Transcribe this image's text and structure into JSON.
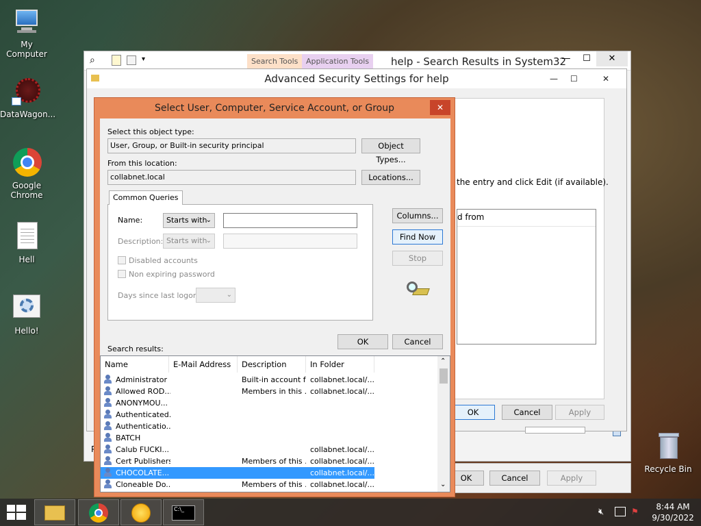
{
  "desktop": {
    "icons": [
      {
        "label": "My Computer"
      },
      {
        "label": "DataWagon..."
      },
      {
        "label": "Google Chrome"
      },
      {
        "label": "Hell"
      },
      {
        "label": "Hello!"
      },
      {
        "label": "Recycle Bin"
      }
    ]
  },
  "explorer": {
    "title": "help - Search Results in System32",
    "tab_search": "Search Tools",
    "tab_app": "Application Tools",
    "btn_min": "—",
    "btn_max": "☐",
    "btn_close": "✕",
    "bottom_letter": "P"
  },
  "advanced": {
    "title": "Advanced Security Settings for help",
    "text_entry": "the entry and click Edit (if available).",
    "col_from": "d from",
    "ok": "OK",
    "cancel": "Cancel",
    "apply": "Apply",
    "ok2": "OK",
    "cancel2": "Cancel",
    "apply2": "Apply"
  },
  "dialog": {
    "title": "Select User, Computer, Service Account, or Group",
    "close": "✕",
    "object_type_label": "Select this object type:",
    "object_type_value": "User, Group, or Built-in security principal",
    "object_types_btn": "Object Types...",
    "location_label": "From this location:",
    "location_value": "collabnet.local",
    "locations_btn": "Locations...",
    "tab_common": "Common Queries",
    "name_label": "Name:",
    "name_combo": "Starts with",
    "desc_label": "Description:",
    "desc_combo": "Starts with",
    "disabled_accounts": "Disabled accounts",
    "non_expiring": "Non expiring password",
    "days_since": "Days since last logon:",
    "columns_btn": "Columns...",
    "find_now_btn": "Find Now",
    "stop_btn": "Stop",
    "ok_btn": "OK",
    "cancel_btn": "Cancel",
    "search_results_label": "Search results:",
    "columns": [
      "Name",
      "E-Mail Address",
      "Description",
      "In Folder"
    ],
    "rows": [
      {
        "name": "Administrator",
        "email": "",
        "desc": "Built-in account f...",
        "folder": "collabnet.local/..."
      },
      {
        "name": "Allowed ROD...",
        "email": "",
        "desc": "Members in this ...",
        "folder": "collabnet.local/..."
      },
      {
        "name": "ANONYMOU...",
        "email": "",
        "desc": "",
        "folder": ""
      },
      {
        "name": "Authenticated...",
        "email": "",
        "desc": "",
        "folder": ""
      },
      {
        "name": "Authenticatio...",
        "email": "",
        "desc": "",
        "folder": ""
      },
      {
        "name": "BATCH",
        "email": "",
        "desc": "",
        "folder": ""
      },
      {
        "name": "Calub FUCKI...",
        "email": "",
        "desc": "",
        "folder": "collabnet.local/..."
      },
      {
        "name": "Cert Publishers",
        "email": "",
        "desc": "Members of this ...",
        "folder": "collabnet.local/..."
      },
      {
        "name": "CHOCOLATE...",
        "email": "",
        "desc": "",
        "folder": "collabnet.local/..."
      },
      {
        "name": "Cloneable Do...",
        "email": "",
        "desc": "Members of this ...",
        "folder": "collabnet.local/..."
      }
    ]
  },
  "taskbar": {
    "time": "8:44 AM",
    "date": "9/30/2022"
  }
}
